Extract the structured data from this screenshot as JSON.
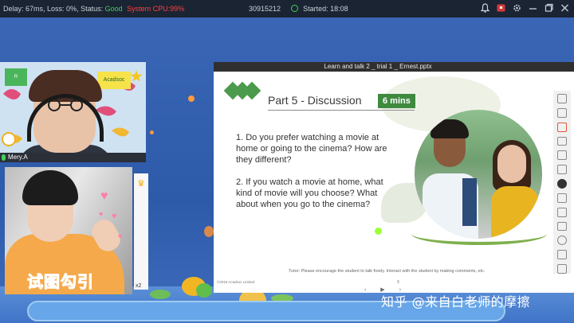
{
  "status_bar": {
    "delay": "Delay: 67ms,",
    "loss": "Loss: 0%,",
    "status_label": "Status:",
    "status_value": "Good",
    "system_text": "System CPU:99%",
    "room_id": "30915212",
    "started": "Started: 18:08",
    "icons": [
      "bell-icon",
      "record-icon",
      "settings-icon",
      "minimize-icon",
      "restore-icon",
      "close-icon"
    ],
    "colors": {
      "good": "#3fd15a",
      "alert": "#ff4040"
    }
  },
  "teacher": {
    "name": "Mery.A",
    "logo_text": "Acadsoc"
  },
  "student": {
    "caption": "试图勾引",
    "badge": "x2"
  },
  "presentation": {
    "window_title": "Learn and talk 2 _ trial 1 _ Ernest.pptx",
    "heading": "Part 5 - Discussion",
    "time_badge": "6 mins",
    "questions": [
      "1. Do you prefer watching a movie at home or going to the cinema? How are they different?",
      "2. If you watch a movie at home, what kind of movie will you choose? What about when you go to the cinema?"
    ],
    "tutor_note": "Tutor: Please encourage the student to talk freely. Interact with the student by making comments, etc.",
    "copyright": "©2018 Acadsoc Limited",
    "page": "9",
    "accent_color": "#3f8a3f"
  },
  "toolbar_icons": [
    "pointer-icon",
    "select-icon",
    "pen-icon",
    "text-icon",
    "scissors-icon",
    "eraser-icon",
    "camera-icon",
    "image-icon",
    "chat-icon",
    "comment-icon",
    "cloud-icon",
    "folder-icon",
    "exit-icon"
  ],
  "watermark": "知乎 @来自白老师的摩擦"
}
